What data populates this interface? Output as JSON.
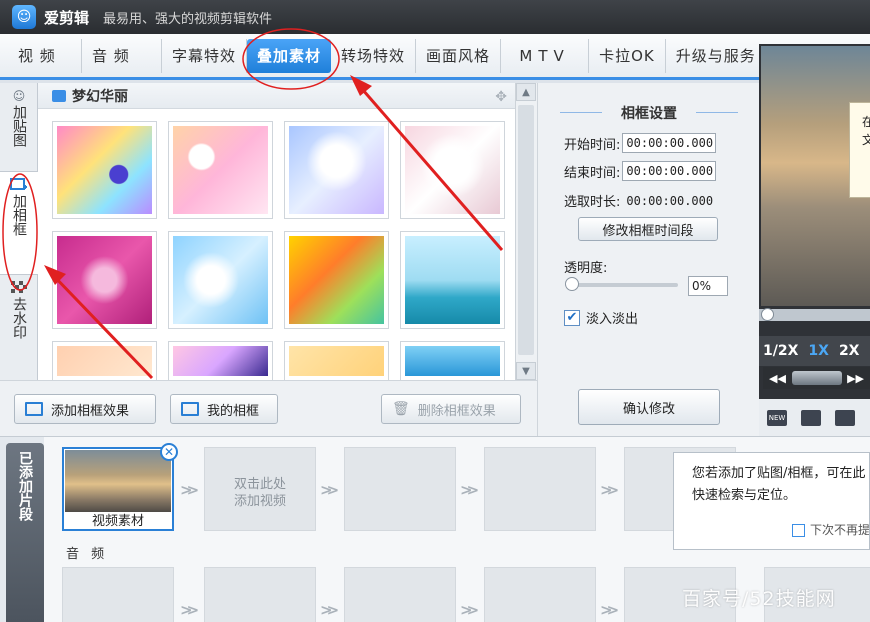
{
  "app": {
    "title": "爱剪辑",
    "subtitle": "最易用、强大的视频剪辑软件"
  },
  "tabs": [
    {
      "label": "视 频"
    },
    {
      "label": "音 频"
    },
    {
      "label": "字幕特效"
    },
    {
      "label": "叠加素材",
      "active": true
    },
    {
      "label": "转场特效"
    },
    {
      "label": "画面风格"
    },
    {
      "label": "MTV"
    },
    {
      "label": "卡拉OK"
    },
    {
      "label": "升级与服务"
    }
  ],
  "side_tabs": [
    {
      "label": "加贴图",
      "icon": "smiley-icon"
    },
    {
      "label": "加相框",
      "icon": "frame-add-icon",
      "active": true
    },
    {
      "label": "去水印",
      "icon": "mosaic-icon"
    }
  ],
  "gallery": {
    "category": "梦幻华丽"
  },
  "gallery_actions": {
    "add_label": "添加相框效果",
    "mine_label": "我的相框",
    "delete_label": "删除相框效果"
  },
  "settings": {
    "title": "相框设置",
    "start_label": "开始时间:",
    "start_value": "00:00:00.000",
    "end_label": "结束时间:",
    "end_value": "00:00:00.000",
    "duration_label": "选取时长:",
    "duration_value": "00:00:00.000",
    "modify_range_label": "修改相框时间段",
    "opacity_label": "透明度:",
    "opacity_value": "0%",
    "opacity_fraction": 0,
    "fade_label": "淡入淡出",
    "fade_checked": true,
    "confirm_label": "确认修改"
  },
  "preview": {
    "popup_text": "在\n文",
    "speeds": [
      "1/2X",
      "1X",
      "2X"
    ],
    "active_speed": "1X"
  },
  "timeline": {
    "added_label": "已添加片段",
    "clip_name": "视频素材",
    "placeholder": "双击此处\n添加视频",
    "audio_label": "音 频"
  },
  "tip": {
    "line1": "您若添加了贴图/相框，可在此",
    "line2": "快速检索与定位。",
    "dont_show": "下次不再提示"
  },
  "watermark": "百家号/52技能网",
  "colors": {
    "accent": "#3a8ee6",
    "annotation": "#e02020"
  }
}
